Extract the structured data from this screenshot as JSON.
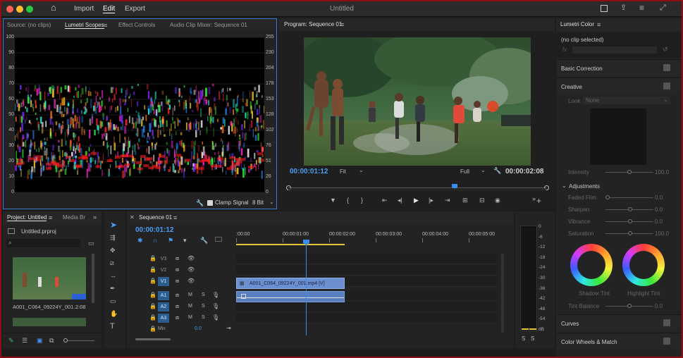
{
  "titlebar": {
    "menu": [
      "Import",
      "Edit",
      "Export"
    ],
    "active_menu": "Edit",
    "title": "Untitled",
    "colors": {
      "close": "#fe5f57",
      "min": "#febc2e",
      "max": "#28c840"
    }
  },
  "source_panel": {
    "tabs": [
      "Source: (no clips)",
      "Lumetri Scopes",
      "Effect Controls",
      "Audio Clip Mixer: Sequence 01"
    ],
    "active_tab": "Lumetri Scopes",
    "scale_left": [
      "100",
      "90",
      "80",
      "70",
      "60",
      "50",
      "40",
      "30",
      "20",
      "10",
      "0"
    ],
    "scale_right": [
      "255",
      "230",
      "204",
      "178",
      "153",
      "128",
      "102",
      "76",
      "51",
      "26",
      "0"
    ],
    "clamp_signal_label": "Clamp Signal",
    "bit_depth": "8 Bit"
  },
  "program_panel": {
    "title": "Program: Sequence 01",
    "timecode_current": "00:00:01:12",
    "fit_value": "Fit",
    "resolution": "Full",
    "timecode_duration": "00:00:02:08",
    "transport_icons": [
      "marker-icon",
      "in-point-icon",
      "out-point-icon",
      "go-to-in-icon",
      "step-back-icon",
      "play-icon",
      "step-forward-icon",
      "go-to-out-icon",
      "lift-icon",
      "extract-icon",
      "export-frame-icon",
      "add-button-icon"
    ]
  },
  "lumetri_panel": {
    "title": "Lumetri Color",
    "clip": "(no clip selected)",
    "fx_label": "fx",
    "sections": {
      "basic": "Basic Correction",
      "creative": "Creative",
      "curves": "Curves",
      "color_wheels": "Color Wheels & Match"
    },
    "look_label": "Look",
    "look_value": "None",
    "intensity": {
      "label": "Intensity",
      "value": "100.0"
    },
    "adjustments_label": "Adjustments",
    "sliders": [
      {
        "label": "Faded Film",
        "value": "0.0",
        "level": 0
      },
      {
        "label": "Sharpen",
        "value": "0.0",
        "level": 0.5
      },
      {
        "label": "Vibrance",
        "value": "0.0",
        "level": 0.5
      },
      {
        "label": "Saturation",
        "value": "100.0",
        "level": 0.5
      }
    ],
    "shadow_tint_label": "Shadow Tint",
    "highlight_tint_label": "Highlight Tint",
    "tint_balance": {
      "label": "Tint Balance",
      "value": "0.0"
    }
  },
  "project_panel": {
    "tabs": [
      "Project: Untitled",
      "Media Br"
    ],
    "active_tab": "Project: Untitled",
    "file_name": "Untitled.prproj",
    "clip_name": "A001_C064_09224Y_001...",
    "clip_duration": "2:08"
  },
  "timeline": {
    "sequence_title": "Sequence 01",
    "timecode": "00:00:01:12",
    "ruler_labels": [
      ":00:00",
      "00:00:01:00",
      "00:00:02:00",
      "00:00:03:00",
      "00:00:04:00",
      "00:00:05:00"
    ],
    "video_tracks": [
      "V3",
      "V2",
      "V1"
    ],
    "audio_tracks": [
      "A1",
      "A2",
      "A3"
    ],
    "mix_label": "Mix",
    "mix_value": "0.0",
    "mute_label": "M",
    "solo_label": "S",
    "clip_label": "A001_C064_09224Y_001.mp4 [V]"
  },
  "audio_meter": {
    "scale": [
      "0",
      "-6",
      "-12",
      "-18",
      "-24",
      "-30",
      "-36",
      "-42",
      "-48",
      "-54",
      "dB"
    ],
    "solo_buttons": [
      "S",
      "S"
    ]
  }
}
